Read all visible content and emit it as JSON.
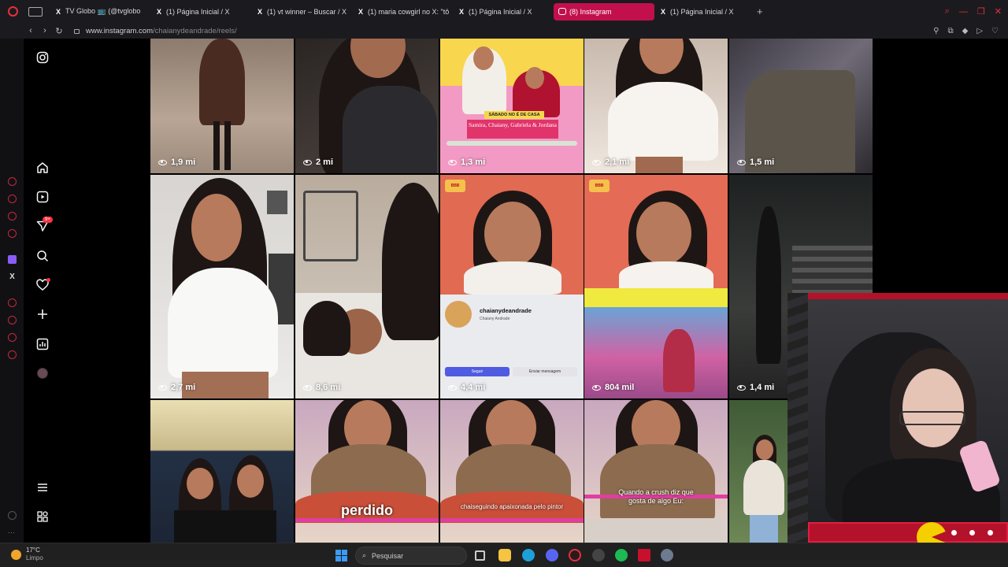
{
  "browser": {
    "tabs": [
      {
        "label": "TV Globo 📺 (@tvglobo",
        "fav": "X",
        "active": false
      },
      {
        "label": "(1) Página Inicial / X",
        "fav": "X",
        "active": false
      },
      {
        "label": "(1) vt winner – Buscar / X",
        "fav": "X",
        "active": false
      },
      {
        "label": "(1) maria cowgirl no X: \"tô",
        "fav": "X",
        "active": false
      },
      {
        "label": "(1) Página Inicial / X",
        "fav": "X",
        "active": false
      },
      {
        "label": "(8) Instagram",
        "fav": "ig",
        "active": true
      },
      {
        "label": "(1) Página Inicial / X",
        "fav": "X",
        "active": false
      }
    ],
    "url_host": "www.instagram.com",
    "url_path": "/chaianydeandrade/reels/"
  },
  "sidebar": {
    "notification_badge": "9+"
  },
  "reels": [
    {
      "views": "1,9 mi"
    },
    {
      "views": "2 mi"
    },
    {
      "views": "1,3 mi"
    },
    {
      "views": "2,1 mi"
    },
    {
      "views": "1,5 mi"
    },
    {
      "views": "2,7 mi"
    },
    {
      "views": "8,6 mi"
    },
    {
      "views": "4,4 mi"
    },
    {
      "views": "804 mil"
    },
    {
      "views": "1,4 mi"
    },
    {
      "views": ""
    },
    {
      "views": ""
    },
    {
      "views": ""
    },
    {
      "views": ""
    },
    {
      "views": ""
    }
  ],
  "reel_texts": {
    "r3_tag": "SÁBADO NO É DE CASA",
    "r3_names": "Samira, Chaiany, Gabriela & Jordana",
    "r8_profile_name": "chaianydeandrade",
    "r8_profile_sub": "Chaiany Andrade",
    "r8_follow": "Seguir",
    "r8_message": "Enviar mensagem",
    "r8_tag": "BBB",
    "r9_tag": "BBB",
    "r12_caption": "perdido",
    "r13_caption": "chaiseguindo apaixonada pelo pintor",
    "r14_caption": "Quando a crush diz que gosta de algo Eu:"
  },
  "taskbar": {
    "temperature": "17°C",
    "condition": "Limpo",
    "search_placeholder": "Pesquisar"
  }
}
